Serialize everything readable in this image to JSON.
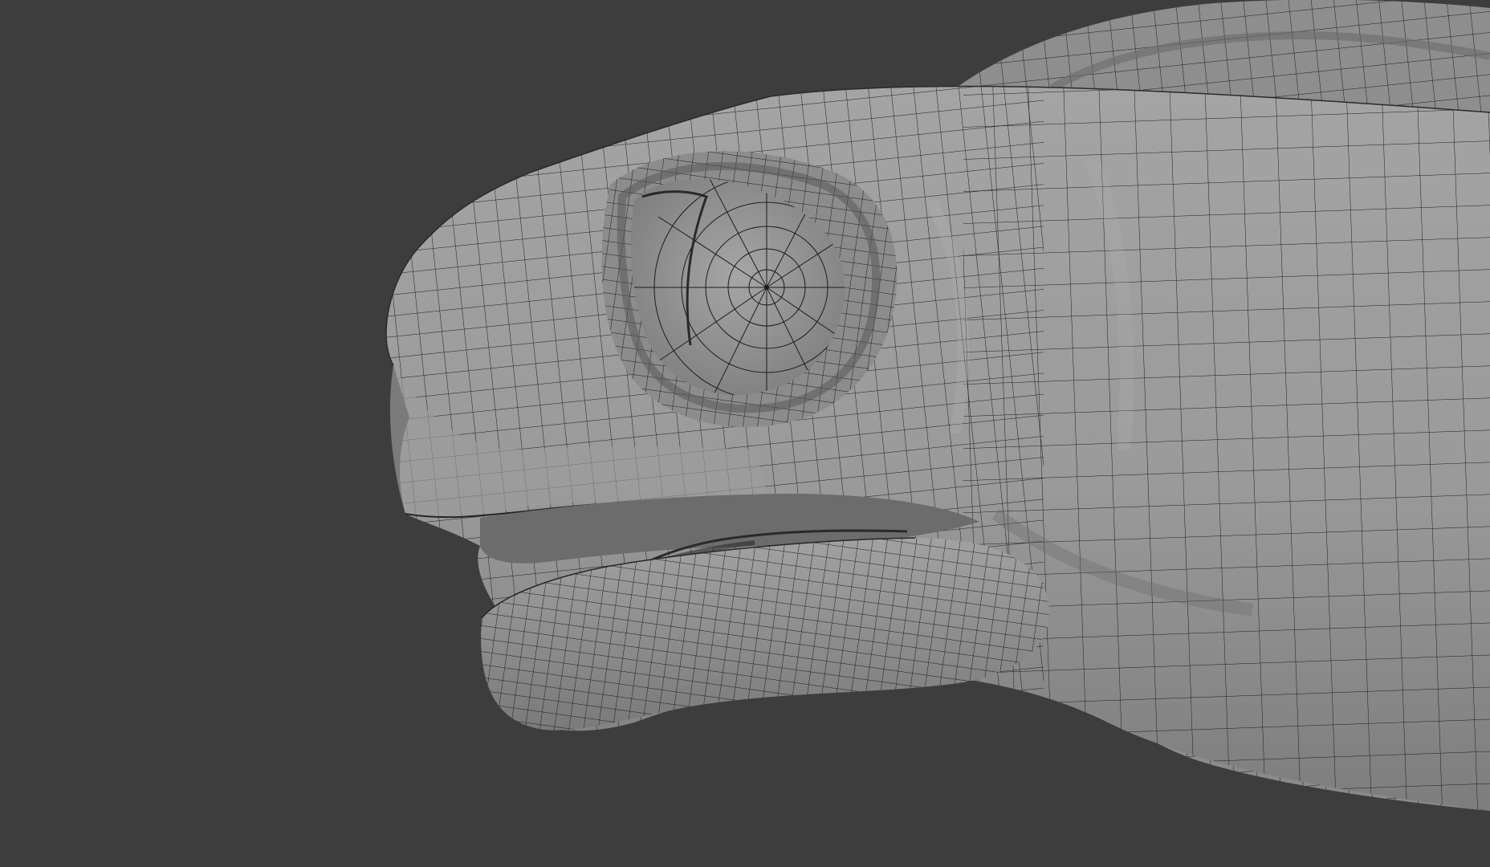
{
  "viewport": {
    "background_color": "#3d3d3d",
    "mesh_fill_color": "#9a9a9a",
    "mesh_light_color": "#a8a8a8",
    "mesh_shadow_color": "#6a6a6a",
    "wire_color": "#1c1c1c"
  }
}
